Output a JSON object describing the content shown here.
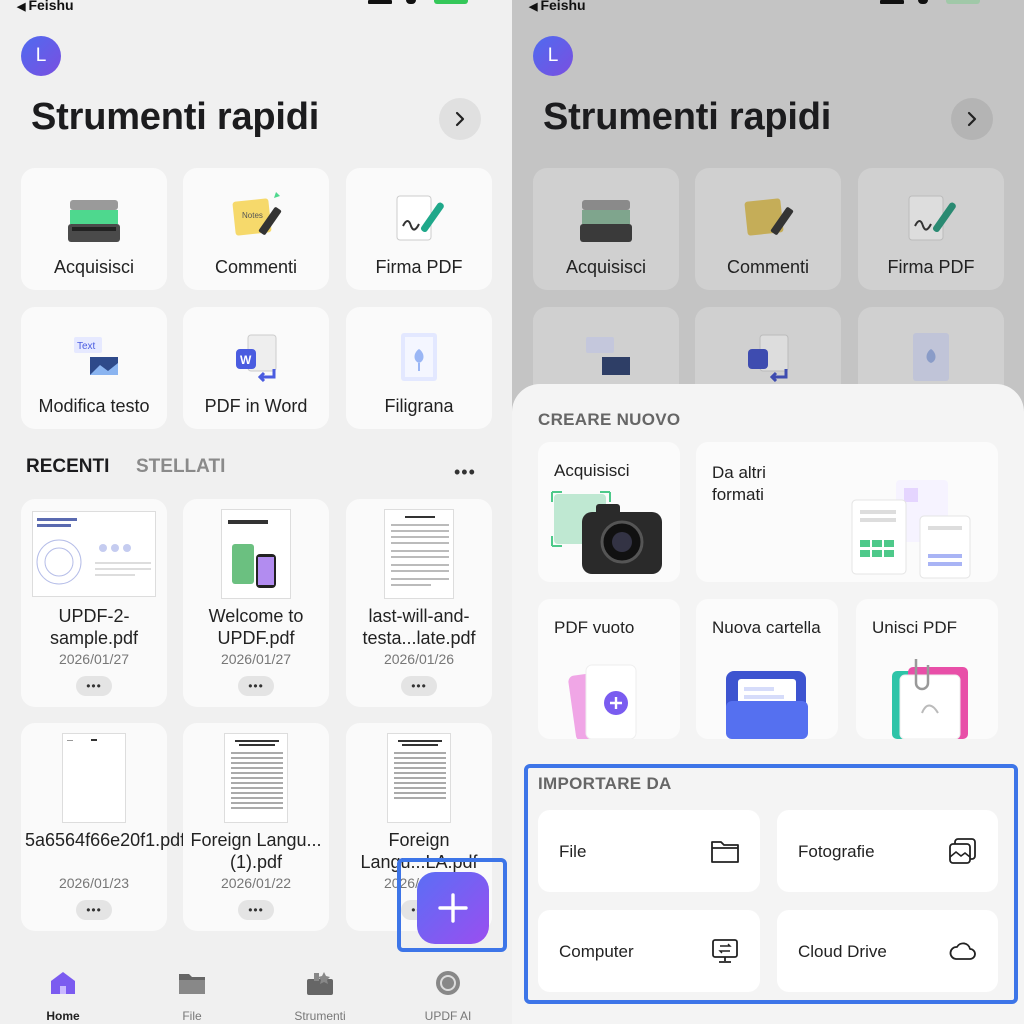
{
  "status_bar": {
    "back_label": "Feishu",
    "back_arrow": "◀"
  },
  "avatar": {
    "initial": "L"
  },
  "header": {
    "title": "Strumenti rapidi"
  },
  "tools": [
    {
      "label": "Acquisisci",
      "icon": "scanner-icon"
    },
    {
      "label": "Commenti",
      "icon": "notes-icon"
    },
    {
      "label": "Firma PDF",
      "icon": "signature-icon"
    },
    {
      "label": "Modifica testo",
      "icon": "edit-text-icon"
    },
    {
      "label": "PDF in Word",
      "icon": "word-icon"
    },
    {
      "label": "Filigrana",
      "icon": "watermark-icon"
    }
  ],
  "tabs": {
    "recent": "RECENTI",
    "starred": "STELLATI"
  },
  "more": "•••",
  "files": [
    {
      "name": "UPDF-2-sample.pdf",
      "date": "2026/01/27"
    },
    {
      "name": "Welcome to UPDF.pdf",
      "date": "2026/01/27"
    },
    {
      "name": "last-will-and-testa...late.pdf",
      "date": "2026/01/26"
    },
    {
      "name": "5a6564f66e20f1.pdf",
      "date": "2026/01/23"
    },
    {
      "name": "Foreign Langu...(1).pdf",
      "date": "2026/01/22"
    },
    {
      "name": "Foreign Langu...LA.pdf",
      "date": "2026/01/22"
    }
  ],
  "file_menu": "•••",
  "nav": [
    {
      "label": "Home",
      "icon": "home-icon"
    },
    {
      "label": "File",
      "icon": "folder-icon"
    },
    {
      "label": "Strumenti",
      "icon": "toolbox-icon"
    },
    {
      "label": "UPDF AI",
      "icon": "ai-icon"
    }
  ],
  "sheet": {
    "create_title": "CREARE NUOVO",
    "create_items": [
      {
        "label": "Acquisisci",
        "icon": "camera-icon"
      },
      {
        "label": "Da altri formati",
        "icon": "documents-icon"
      },
      {
        "label": "PDF vuoto",
        "icon": "blank-pdf-icon"
      },
      {
        "label": "Nuova cartella",
        "icon": "new-folder-icon"
      },
      {
        "label": "Unisci PDF",
        "icon": "merge-pdf-icon"
      }
    ],
    "import_title": "IMPORTARE DA",
    "import_items": [
      {
        "label": "File",
        "icon": "folder-outline-icon"
      },
      {
        "label": "Fotografie",
        "icon": "photos-icon"
      },
      {
        "label": "Computer",
        "icon": "computer-icon"
      },
      {
        "label": "Cloud Drive",
        "icon": "cloud-icon"
      }
    ]
  },
  "colors": {
    "accent": "#3d75e8",
    "fab_start": "#5b6ef5",
    "fab_end": "#9a4ef0",
    "battery": "#34c759"
  }
}
